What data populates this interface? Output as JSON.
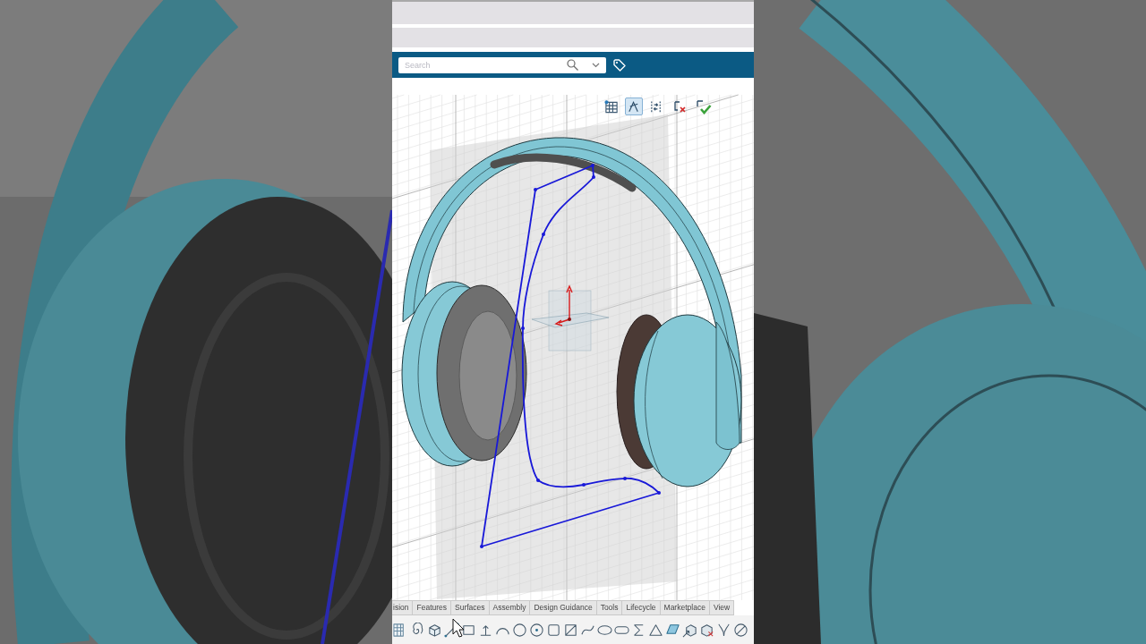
{
  "search": {
    "placeholder": "Search"
  },
  "sketch_toolbar": {
    "tools": [
      {
        "selected": false
      },
      {
        "selected": true
      },
      {
        "selected": false
      }
    ]
  },
  "ribbon_tabs": [
    {
      "label": "ision",
      "selected": false
    },
    {
      "label": "Features",
      "selected": false
    },
    {
      "label": "Surfaces",
      "selected": false
    },
    {
      "label": "Assembly",
      "selected": false
    },
    {
      "label": "Design Guidance",
      "selected": false
    },
    {
      "label": "Tools",
      "selected": false
    },
    {
      "label": "Lifecycle",
      "selected": false
    },
    {
      "label": "Marketplace",
      "selected": false
    },
    {
      "label": "View",
      "selected": false
    }
  ]
}
